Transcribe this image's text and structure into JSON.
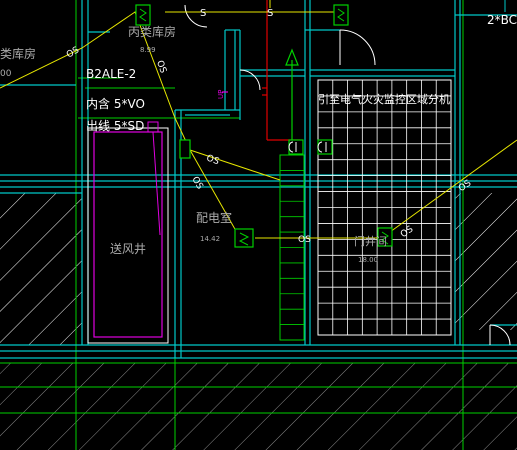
{
  "drawing": {
    "colors": {
      "background": "#000000",
      "wall": "#00c8c8",
      "grid_line": "#00d000",
      "cable": "#e6e600",
      "text_white": "#ffffff",
      "text_gray": "#aaaaaa",
      "magenta": "#e000e0",
      "red_wire": "#e00000",
      "hatch": "#ffffff"
    },
    "labels": {
      "room_anti_class": "丙类库房",
      "room_anti_class_area": "8.99",
      "room_left": "类库房",
      "room_left_code": "00",
      "panel_id": "B2ALE-2",
      "inner_line": "内含 5*VO",
      "out_line": "出线 5*SD",
      "air_shaft": "送风井",
      "switch_room": "配电室",
      "switch_room_area": "14.42",
      "note_monitor": "引至电气火灾监控区域分机",
      "room_right": "门井间",
      "room_right_area": "18.00",
      "axis_tag": "2*BC",
      "arrow_tag": "UP",
      "cable_mark": "S",
      "cable_mark_os": "OS"
    }
  }
}
